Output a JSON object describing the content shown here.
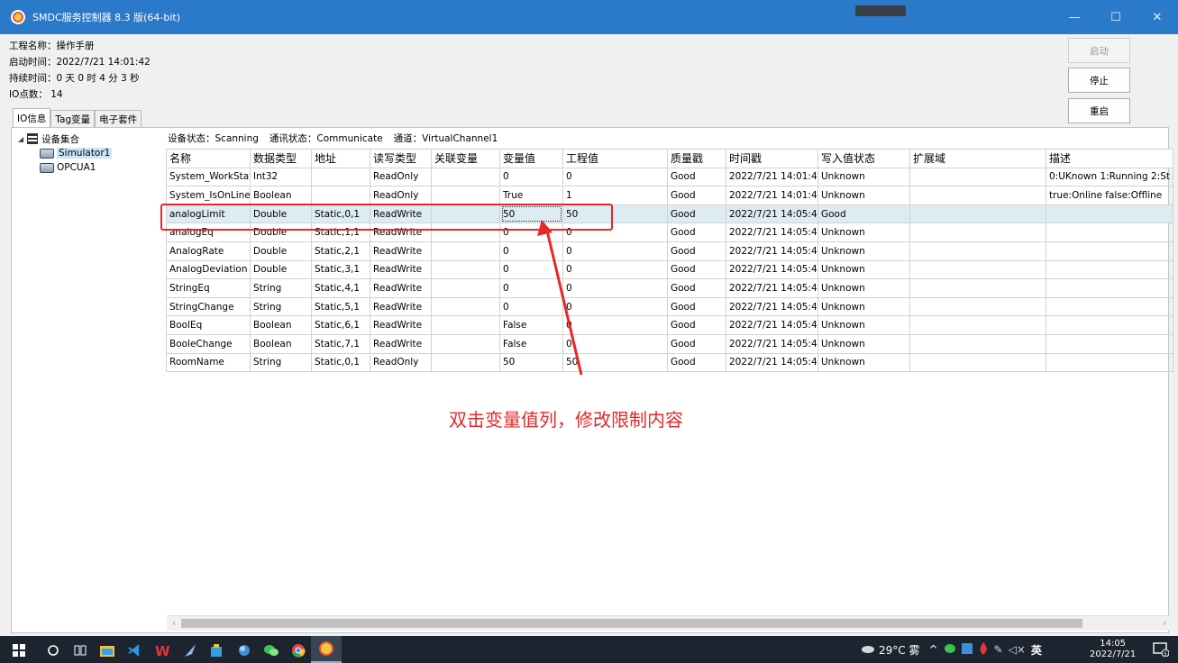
{
  "window": {
    "title": "SMDC服务控制器 8.3 版(64-bit)",
    "minimize": "—",
    "maximize": "☐",
    "close": "✕"
  },
  "info": {
    "project": "工程名称：操作手册",
    "start_time": "启动时间：2022/7/21 14:01:42",
    "duration": "持续时间：0 天 0 时 4 分 3 秒",
    "io_count": "IO点数：   14"
  },
  "buttons": {
    "start": "启动",
    "stop": "停止",
    "restart": "重启"
  },
  "tabs": [
    "IO信息",
    "Tag变量",
    "电子套件"
  ],
  "tree": {
    "root": "设备集合",
    "devices": [
      "Simulator1",
      "OPCUA1"
    ]
  },
  "status": {
    "device": "设备状态：Scanning",
    "comm": "通讯状态：Communicate",
    "channel": "通道：VirtualChannel1"
  },
  "table": {
    "headers": [
      "名称",
      "数据类型",
      "地址",
      "读写类型",
      "关联变量",
      "变量值",
      "工程值",
      "质量戳",
      "时间戳",
      "写入值状态",
      "扩展域",
      "描述"
    ],
    "rows": [
      [
        "System_WorkState",
        "Int32",
        "",
        "ReadOnly",
        "",
        "0",
        "0",
        "Good",
        "2022/7/21 14:01:45",
        "Unknown",
        "",
        "0:UKnown 1:Running 2:St"
      ],
      [
        "System_IsOnLine",
        "Boolean",
        "",
        "ReadOnly",
        "",
        "True",
        "1",
        "Good",
        "2022/7/21 14:01:45",
        "Unknown",
        "",
        "true:Online false:Offline"
      ],
      [
        "analogLimit",
        "Double",
        "Static,0,1",
        "ReadWrite",
        "",
        "50",
        "50",
        "Good",
        "2022/7/21 14:05:45",
        "Good",
        "",
        ""
      ],
      [
        "analogEq",
        "Double",
        "Static,1,1",
        "ReadWrite",
        "",
        "0",
        "0",
        "Good",
        "2022/7/21 14:05:45",
        "Unknown",
        "",
        ""
      ],
      [
        "AnalogRate",
        "Double",
        "Static,2,1",
        "ReadWrite",
        "",
        "0",
        "0",
        "Good",
        "2022/7/21 14:05:45",
        "Unknown",
        "",
        ""
      ],
      [
        "AnalogDeviation",
        "Double",
        "Static,3,1",
        "ReadWrite",
        "",
        "0",
        "0",
        "Good",
        "2022/7/21 14:05:45",
        "Unknown",
        "",
        ""
      ],
      [
        "StringEq",
        "String",
        "Static,4,1",
        "ReadWrite",
        "",
        "0",
        "0",
        "Good",
        "2022/7/21 14:05:45",
        "Unknown",
        "",
        ""
      ],
      [
        "StringChange",
        "String",
        "Static,5,1",
        "ReadWrite",
        "",
        "0",
        "0",
        "Good",
        "2022/7/21 14:05:45",
        "Unknown",
        "",
        ""
      ],
      [
        "BoolEq",
        "Boolean",
        "Static,6,1",
        "ReadWrite",
        "",
        "False",
        "0",
        "Good",
        "2022/7/21 14:05:45",
        "Unknown",
        "",
        ""
      ],
      [
        "BooleChange",
        "Boolean",
        "Static,7,1",
        "ReadWrite",
        "",
        "False",
        "0",
        "Good",
        "2022/7/21 14:05:45",
        "Unknown",
        "",
        ""
      ],
      [
        "RoomName",
        "String",
        "Static,0,1",
        "ReadOnly",
        "",
        "50",
        "50",
        "Good",
        "2022/7/21 14:05:45",
        "Unknown",
        "",
        ""
      ]
    ],
    "selected_row": 2
  },
  "annotation": {
    "text": "双击变量值列，修改限制内容",
    "color": "#e62828"
  },
  "taskbar": {
    "weather": "29°C 雾",
    "lang": "英",
    "time": "14:05",
    "date": "2022/7/21",
    "notify_count": "5"
  },
  "colors": {
    "titlebar": "#2b79c9",
    "selection": "#dcecf1",
    "annotation": "#e62828",
    "taskbar": "#1c2430"
  }
}
